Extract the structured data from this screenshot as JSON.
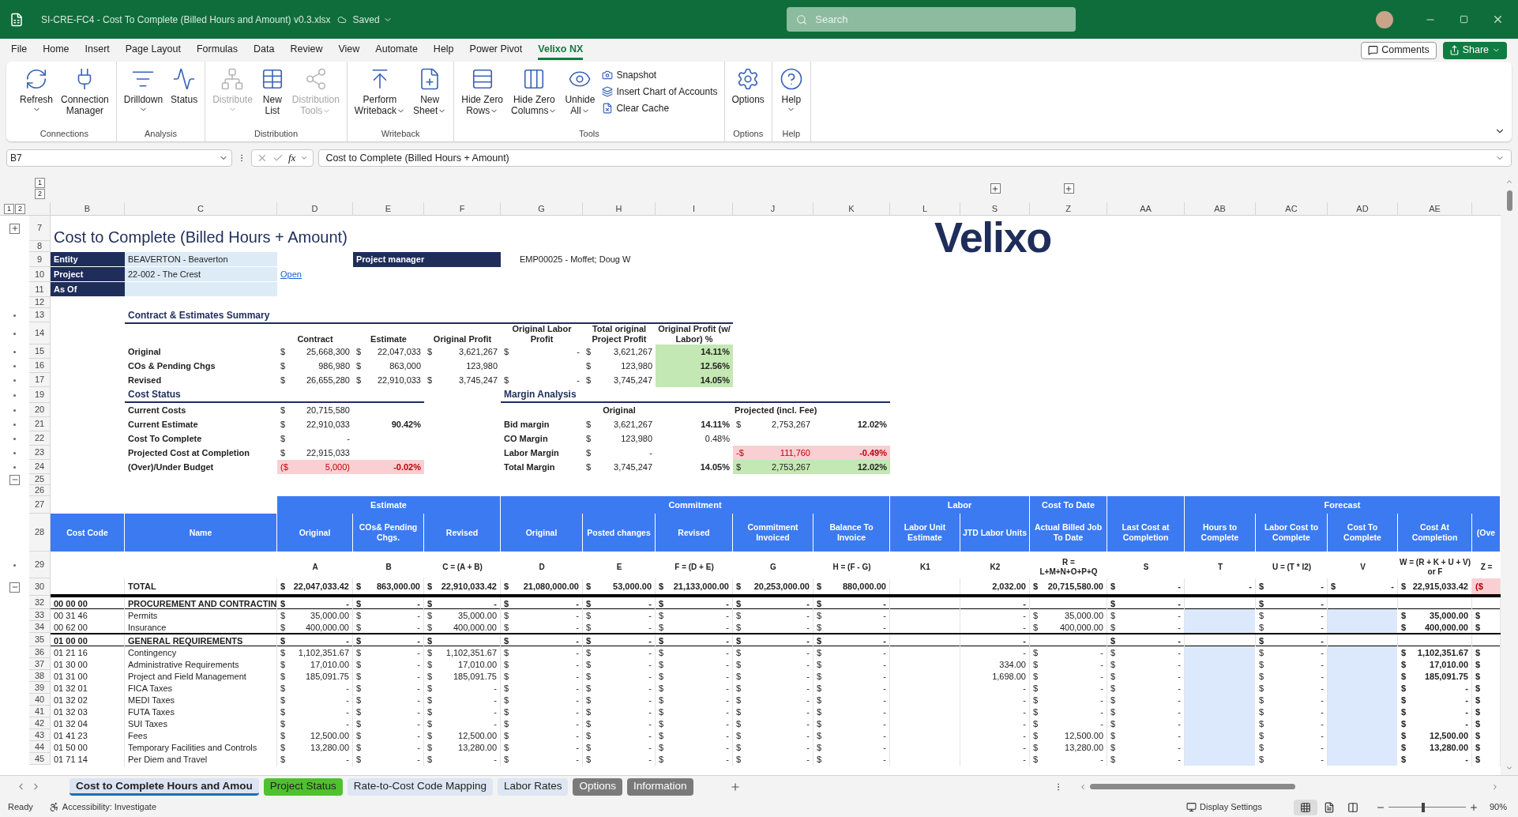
{
  "window": {
    "file_name": "SI-CRE-FC4 - Cost To Complete (Billed Hours and Amount) v0.3.xlsx",
    "save_status": "Saved",
    "search_placeholder": "Search"
  },
  "menu": [
    {
      "label": "File",
      "selected": false
    },
    {
      "label": "Home",
      "selected": false
    },
    {
      "label": "Insert",
      "selected": false
    },
    {
      "label": "Page Layout",
      "selected": false
    },
    {
      "label": "Formulas",
      "selected": false
    },
    {
      "label": "Data",
      "selected": false
    },
    {
      "label": "Review",
      "selected": false
    },
    {
      "label": "View",
      "selected": false
    },
    {
      "label": "Automate",
      "selected": false
    },
    {
      "label": "Help",
      "selected": false
    },
    {
      "label": "Power Pivot",
      "selected": false
    },
    {
      "label": "Velixo NX",
      "selected": true
    }
  ],
  "menu_actions": {
    "comments": "Comments",
    "share": "Share"
  },
  "ribbon": [
    {
      "label": "Connections",
      "buttons": [
        {
          "label": "Refresh",
          "kind": "large",
          "dropdown": true,
          "disabled": false
        },
        {
          "label": "Connection\nManager",
          "kind": "large",
          "dropdown": false,
          "disabled": false
        }
      ]
    },
    {
      "label": "Analysis",
      "buttons": [
        {
          "label": "Drilldown",
          "kind": "large",
          "dropdown": true,
          "disabled": false
        },
        {
          "label": "Status",
          "kind": "large",
          "dropdown": false,
          "disabled": false
        }
      ]
    },
    {
      "label": "Distribution",
      "buttons": [
        {
          "label": "Distribute",
          "kind": "large",
          "dropdown": true,
          "disabled": true
        },
        {
          "label": "New\nList",
          "kind": "large",
          "dropdown": false,
          "disabled": false
        },
        {
          "label": "Distribution\nTools",
          "kind": "large",
          "dropdown": true,
          "disabled": true
        }
      ]
    },
    {
      "label": "Writeback",
      "buttons": [
        {
          "label": "Perform\nWriteback",
          "kind": "large",
          "dropdown": true,
          "disabled": false
        },
        {
          "label": "New\nSheet",
          "kind": "large",
          "dropdown": true,
          "disabled": false
        }
      ]
    },
    {
      "label": "Tools",
      "buttons": [
        {
          "label": "Hide Zero\nRows",
          "kind": "large",
          "dropdown": true,
          "disabled": false
        },
        {
          "label": "Hide Zero\nColumns",
          "kind": "large",
          "dropdown": true,
          "disabled": false
        },
        {
          "label": "Unhide\nAll",
          "kind": "large",
          "dropdown": true,
          "disabled": false
        },
        {
          "label": "Snapshot",
          "kind": "small",
          "dropdown": false,
          "disabled": false
        },
        {
          "label": "Insert Chart of Accounts",
          "kind": "small",
          "dropdown": false,
          "disabled": false
        },
        {
          "label": "Clear Cache",
          "kind": "small",
          "dropdown": false,
          "disabled": false
        }
      ]
    },
    {
      "label": "Options",
      "buttons": [
        {
          "label": "Options",
          "kind": "large",
          "dropdown": false,
          "disabled": false
        }
      ]
    },
    {
      "label": "Help",
      "buttons": [
        {
          "label": "Help",
          "kind": "large",
          "dropdown": true,
          "disabled": false
        }
      ]
    }
  ],
  "formula_bar": {
    "name_box": "B7",
    "function_label": "fx",
    "content": "Cost to Complete (Billed Hours + Amount)"
  },
  "sheet": {
    "column_outline_levels": [
      "1",
      "2"
    ],
    "row_outline_levels": [
      "1",
      "2"
    ],
    "column_letters": [
      "B",
      "C",
      "D",
      "E",
      "F",
      "G",
      "H",
      "I",
      "J",
      "K",
      "L",
      "S",
      "Z",
      "AA",
      "AB",
      "AC",
      "AD",
      "AE"
    ],
    "logo_text": "Velixo",
    "rows": [
      {
        "number": "7",
        "kind": "title",
        "outline": {
          "kind": "expand"
        },
        "text": "Cost to Complete (Billed Hours + Amount)"
      },
      {
        "number": "8",
        "kind": "blank"
      },
      {
        "number": "9",
        "kind": "field",
        "label": "Entity",
        "value": "BEAVERTON - Beaverton",
        "side_label": "Project manager",
        "side_value": "EMP00025 - Moffet; Doug W"
      },
      {
        "number": "10",
        "kind": "field",
        "label": "Project",
        "value": "22-002 - The Crest",
        "link": "Open"
      },
      {
        "number": "11",
        "kind": "field",
        "label": "As Of"
      },
      {
        "number": "12",
        "kind": "blank"
      },
      {
        "number": "13",
        "kind": "section",
        "outline": {
          "kind": "dot"
        },
        "text": "Contract & Estimates Summary"
      },
      {
        "number": "14",
        "kind": "summary_header",
        "outline": {
          "kind": "dot"
        },
        "cells": [
          "Contract",
          "Estimate",
          "Original Profit",
          "Original Labor Profit",
          "Total original Project Profit",
          "Original Profit (w/ Labor) %"
        ]
      },
      {
        "number": "15",
        "kind": "summary",
        "outline": {
          "kind": "dot"
        },
        "label": "Original",
        "cells": [
          {
            "sym": "$",
            "value": "25,668,300"
          },
          {
            "sym": "$",
            "value": "22,047,033"
          },
          {
            "sym": "$",
            "value": "3,621,267"
          },
          {
            "sym": "$",
            "value": "-"
          },
          {
            "sym": "$",
            "value": "3,621,267"
          },
          {
            "value": "14.11%",
            "kind": "good",
            "bold": true
          }
        ]
      },
      {
        "number": "16",
        "kind": "summary",
        "outline": {
          "kind": "dot"
        },
        "label": "COs & Pending Chgs",
        "cells": [
          {
            "sym": "$",
            "value": "986,980"
          },
          {
            "sym": "$",
            "value": "863,000"
          },
          {
            "value": "123,980"
          },
          {},
          {
            "sym": "$",
            "value": "123,980"
          },
          {
            "value": "12.56%",
            "kind": "good",
            "bold": true
          }
        ]
      },
      {
        "number": "17",
        "kind": "summary",
        "outline": {
          "kind": "dot"
        },
        "label": "Revised",
        "cells": [
          {
            "sym": "$",
            "value": "26,655,280"
          },
          {
            "sym": "$",
            "value": "22,910,033"
          },
          {
            "sym": "$",
            "value": "3,745,247"
          },
          {
            "sym": "$",
            "value": "-"
          },
          {
            "sym": "$",
            "value": "3,745,247"
          },
          {
            "value": "14.05%",
            "kind": "good",
            "bold": true
          }
        ]
      },
      {
        "number": "19",
        "kind": "split_titles",
        "outline": {
          "kind": "dot"
        },
        "cost_title": "Cost Status",
        "margin_title": "Margin Analysis"
      },
      {
        "number": "20",
        "kind": "split",
        "outline": {
          "kind": "dot"
        },
        "cost": {
          "label": "Current Costs",
          "amount": {
            "sym": "$",
            "value": "20,715,580"
          }
        },
        "margin_header": {
          "original": "Original",
          "projected": "Projected (incl. Fee)"
        }
      },
      {
        "number": "21",
        "kind": "split",
        "outline": {
          "kind": "dot"
        },
        "cost": {
          "label": "Current Estimate",
          "amount": {
            "sym": "$",
            "value": "22,910,033"
          },
          "percent": {
            "value": "90.42%",
            "bold": true
          }
        },
        "margin": {
          "label": "Bid margin",
          "original": {
            "sym": "$",
            "value": "3,621,267"
          },
          "original_pct": {
            "value": "14.11%",
            "bold": true
          },
          "projected": {
            "sym": "$",
            "value": "2,753,267"
          },
          "projected_pct": {
            "value": "12.02%",
            "bold": true
          }
        }
      },
      {
        "number": "22",
        "kind": "split",
        "outline": {
          "kind": "dot"
        },
        "cost": {
          "label": "Cost To Complete",
          "amount": {
            "sym": "$",
            "value": "-"
          }
        },
        "margin": {
          "label": "CO Margin",
          "original": {
            "sym": "$",
            "value": "123,980"
          },
          "original_pct": {
            "value": "0.48%",
            "bold": false
          }
        }
      },
      {
        "number": "23",
        "kind": "split",
        "outline": {
          "kind": "dot"
        },
        "cost": {
          "label": "Projected Cost at Completion",
          "amount": {
            "sym": "$",
            "value": "22,915,033"
          }
        },
        "margin": {
          "label": "Labor Margin",
          "original": {
            "sym": "$",
            "value": "-"
          },
          "projected": {
            "sym": "-$",
            "value": "111,760",
            "kind": "bad"
          },
          "projected_pct": {
            "value": "-0.49%",
            "kind": "bad",
            "bold": true
          }
        }
      },
      {
        "number": "24",
        "kind": "split",
        "outline": {
          "kind": "dot"
        },
        "cost": {
          "label": "(Over)/Under Budget",
          "amount": {
            "sym": "($",
            "value": "5,000)",
            "kind": "bad"
          },
          "percent": {
            "value": "-0.02%",
            "kind": "bad",
            "bold": true
          }
        },
        "margin": {
          "label": "Total Margin",
          "original": {
            "sym": "$",
            "value": "3,745,247"
          },
          "original_pct": {
            "value": "14.05%",
            "bold": true
          },
          "projected": {
            "sym": "$",
            "value": "2,753,267",
            "kind": "good"
          },
          "projected_pct": {
            "value": "12.02%",
            "kind": "good",
            "bold": true
          }
        }
      },
      {
        "number": "25",
        "kind": "blank",
        "outline": {
          "kind": "collapse"
        }
      },
      {
        "number": "26",
        "kind": "blank"
      },
      {
        "number": "27",
        "kind": "group_header"
      },
      {
        "number": "28",
        "kind": "column_header"
      },
      {
        "number": "29",
        "kind": "formula",
        "outline": {
          "kind": "dot"
        }
      },
      {
        "number": "30",
        "kind": "total",
        "outline": {
          "kind": "collapse"
        },
        "name": "TOTAL",
        "cells": [
          {
            "sym": "$",
            "value": "22,047,033.42"
          },
          {
            "sym": "$",
            "value": "863,000.00"
          },
          {
            "sym": "$",
            "value": "22,910,033.42"
          },
          {
            "sym": "$",
            "value": "21,080,000.00"
          },
          {
            "sym": "$",
            "value": "53,000.00"
          },
          {
            "sym": "$",
            "value": "21,133,000.00"
          },
          {
            "sym": "$",
            "value": "20,253,000.00"
          },
          {
            "sym": "$",
            "value": "880,000.00"
          },
          {},
          {
            "value": "2,032.00"
          },
          {
            "sym": "$",
            "value": "20,715,580.00"
          },
          {
            "sym": "$",
            "value": "-"
          },
          {
            "value": "-"
          },
          {
            "sym": "$",
            "value": "-"
          },
          {
            "sym": "$",
            "value": "-"
          },
          {
            "sym": "$",
            "value": "22,915,033.42"
          },
          {
            "sym": "($",
            "kind": "bad"
          }
        ]
      },
      {
        "number": "32",
        "kind": "group",
        "code": "00 00 00",
        "name": "PROCUREMENT AND CONTRACTIN",
        "cells": [
          {
            "sym": "$",
            "value": "-"
          },
          {
            "sym": "$",
            "value": "-"
          },
          {
            "sym": "$",
            "value": "-"
          },
          {
            "sym": "$",
            "value": "-"
          },
          {
            "sym": "$",
            "value": "-"
          },
          {
            "sym": "$",
            "value": "-"
          },
          {
            "sym": "$",
            "value": "-"
          },
          {
            "sym": "$",
            "value": "-"
          },
          {},
          {
            "value": "-"
          },
          {},
          {
            "sym": "$",
            "value": "-"
          },
          {},
          {
            "sym": "$",
            "value": "-"
          },
          {},
          {},
          {}
        ]
      },
      {
        "number": "33",
        "kind": "item",
        "code": "00 31 46",
        "name": "Permits",
        "cells": [
          {
            "sym": "$",
            "value": "35,000.00"
          },
          {
            "sym": "$",
            "value": "-"
          },
          {
            "sym": "$",
            "value": "35,000.00"
          },
          {
            "sym": "$",
            "value": "-"
          },
          {
            "sym": "$",
            "value": "-"
          },
          {
            "sym": "$",
            "value": "-"
          },
          {
            "sym": "$",
            "value": "-"
          },
          {
            "sym": "$",
            "value": "-"
          },
          {},
          {
            "value": "-"
          },
          {
            "sym": "$",
            "value": "35,000.00"
          },
          {
            "sym": "$",
            "value": "-"
          },
          {
            "kind": "input"
          },
          {
            "sym": "$",
            "value": "-"
          },
          {
            "kind": "input"
          },
          {
            "sym": "$",
            "value": "35,000.00",
            "bold": true
          },
          {
            "sym": "$",
            "bold": true
          }
        ]
      },
      {
        "number": "34",
        "kind": "item",
        "code": "00 62 00",
        "name": "Insurance",
        "cells": [
          {
            "sym": "$",
            "value": "400,000.00"
          },
          {
            "sym": "$",
            "value": "-"
          },
          {
            "sym": "$",
            "value": "400,000.00"
          },
          {
            "sym": "$",
            "value": "-"
          },
          {
            "sym": "$",
            "value": "-"
          },
          {
            "sym": "$",
            "value": "-"
          },
          {
            "sym": "$",
            "value": "-"
          },
          {
            "sym": "$",
            "value": "-"
          },
          {},
          {
            "value": "-"
          },
          {
            "sym": "$",
            "value": "400,000.00"
          },
          {
            "sym": "$",
            "value": "-"
          },
          {
            "kind": "input"
          },
          {
            "sym": "$",
            "value": "-"
          },
          {
            "kind": "input"
          },
          {
            "sym": "$",
            "value": "400,000.00",
            "bold": true
          },
          {
            "sym": "$",
            "bold": true
          }
        ]
      },
      {
        "number": "35",
        "kind": "group",
        "code": "01 00 00",
        "name": "GENERAL REQUIREMENTS",
        "cells": [
          {
            "sym": "$",
            "value": "-"
          },
          {
            "sym": "$",
            "value": "-"
          },
          {
            "sym": "$"
          },
          {
            "sym": "$",
            "value": "-"
          },
          {
            "sym": "$",
            "value": "-"
          },
          {
            "sym": "$",
            "value": "-"
          },
          {
            "sym": "$",
            "value": "-"
          },
          {
            "sym": "$",
            "value": "-"
          },
          {},
          {
            "value": "-"
          },
          {},
          {
            "sym": "$",
            "value": "-"
          },
          {},
          {
            "sym": "$",
            "value": "-"
          },
          {},
          {},
          {}
        ]
      },
      {
        "number": "36",
        "kind": "item",
        "code": "01 21 16",
        "name": "Contingency",
        "cells": [
          {
            "sym": "$",
            "value": "1,102,351.67"
          },
          {
            "sym": "$",
            "value": "-"
          },
          {
            "sym": "$",
            "value": "1,102,351.67"
          },
          {
            "sym": "$",
            "value": "-"
          },
          {
            "sym": "$",
            "value": "-"
          },
          {
            "sym": "$",
            "value": "-"
          },
          {
            "sym": "$",
            "value": "-"
          },
          {
            "sym": "$",
            "value": "-"
          },
          {},
          {
            "value": "-"
          },
          {
            "sym": "$",
            "value": "-"
          },
          {
            "sym": "$",
            "value": "-"
          },
          {
            "kind": "input"
          },
          {
            "sym": "$",
            "value": "-"
          },
          {
            "kind": "input"
          },
          {
            "sym": "$",
            "value": "1,102,351.67",
            "bold": true
          },
          {
            "sym": "$",
            "bold": true
          }
        ]
      },
      {
        "number": "37",
        "kind": "item",
        "code": "01 30 00",
        "name": "Administrative Requirements",
        "cells": [
          {
            "sym": "$",
            "value": "17,010.00"
          },
          {
            "sym": "$",
            "value": "-"
          },
          {
            "sym": "$",
            "value": "17,010.00"
          },
          {
            "sym": "$",
            "value": "-"
          },
          {
            "sym": "$",
            "value": "-"
          },
          {
            "sym": "$",
            "value": "-"
          },
          {
            "sym": "$",
            "value": "-"
          },
          {
            "sym": "$",
            "value": "-"
          },
          {},
          {
            "value": "334.00"
          },
          {
            "sym": "$",
            "value": "-"
          },
          {
            "sym": "$",
            "value": "-"
          },
          {
            "kind": "input"
          },
          {
            "sym": "$",
            "value": "-"
          },
          {
            "kind": "input"
          },
          {
            "sym": "$",
            "value": "17,010.00",
            "bold": true
          },
          {
            "sym": "$",
            "bold": true
          }
        ]
      },
      {
        "number": "38",
        "kind": "item",
        "code": "01 31 00",
        "name": "Project and Field Management",
        "cells": [
          {
            "sym": "$",
            "value": "185,091.75"
          },
          {
            "sym": "$",
            "value": "-"
          },
          {
            "sym": "$",
            "value": "185,091.75"
          },
          {
            "sym": "$",
            "value": "-"
          },
          {
            "sym": "$",
            "value": "-"
          },
          {
            "sym": "$",
            "value": "-"
          },
          {
            "sym": "$",
            "value": "-"
          },
          {
            "sym": "$",
            "value": "-"
          },
          {},
          {
            "value": "1,698.00"
          },
          {
            "sym": "$",
            "value": "-"
          },
          {
            "sym": "$",
            "value": "-"
          },
          {
            "kind": "input"
          },
          {
            "sym": "$",
            "value": "-"
          },
          {
            "kind": "input"
          },
          {
            "sym": "$",
            "value": "185,091.75",
            "bold": true
          },
          {
            "sym": "$",
            "bold": true
          }
        ]
      },
      {
        "number": "39",
        "kind": "item",
        "code": "01 32 01",
        "name": "FICA Taxes",
        "cells": [
          {
            "sym": "$",
            "value": "-"
          },
          {
            "sym": "$",
            "value": "-"
          },
          {
            "sym": "$",
            "value": "-"
          },
          {
            "sym": "$",
            "value": "-"
          },
          {
            "sym": "$",
            "value": "-"
          },
          {
            "sym": "$",
            "value": "-"
          },
          {
            "sym": "$",
            "value": "-"
          },
          {
            "sym": "$",
            "value": "-"
          },
          {},
          {
            "value": "-"
          },
          {
            "sym": "$",
            "value": "-"
          },
          {
            "sym": "$",
            "value": "-"
          },
          {
            "kind": "input"
          },
          {
            "sym": "$",
            "value": "-"
          },
          {
            "kind": "input"
          },
          {
            "sym": "$",
            "value": "-",
            "bold": true
          },
          {
            "sym": "$",
            "bold": true
          }
        ]
      },
      {
        "number": "40",
        "kind": "item",
        "code": "01 32 02",
        "name": "MEDI Taxes",
        "cells": [
          {
            "sym": "$",
            "value": "-"
          },
          {
            "sym": "$",
            "value": "-"
          },
          {
            "sym": "$",
            "value": "-"
          },
          {
            "sym": "$",
            "value": "-"
          },
          {
            "sym": "$",
            "value": "-"
          },
          {
            "sym": "$",
            "value": "-"
          },
          {
            "sym": "$",
            "value": "-"
          },
          {
            "sym": "$",
            "value": "-"
          },
          {},
          {
            "value": "-"
          },
          {
            "sym": "$",
            "value": "-"
          },
          {
            "sym": "$",
            "value": "-"
          },
          {
            "kind": "input"
          },
          {
            "sym": "$",
            "value": "-"
          },
          {
            "kind": "input"
          },
          {
            "sym": "$",
            "value": "-",
            "bold": true
          },
          {
            "sym": "$",
            "bold": true
          }
        ]
      },
      {
        "number": "41",
        "kind": "item",
        "code": "01 32 03",
        "name": "FUTA Taxes",
        "cells": [
          {
            "sym": "$",
            "value": "-"
          },
          {
            "sym": "$",
            "value": "-"
          },
          {
            "sym": "$",
            "value": "-"
          },
          {
            "sym": "$",
            "value": "-"
          },
          {
            "sym": "$",
            "value": "-"
          },
          {
            "sym": "$",
            "value": "-"
          },
          {
            "sym": "$",
            "value": "-"
          },
          {
            "sym": "$",
            "value": "-"
          },
          {},
          {
            "value": "-"
          },
          {
            "sym": "$",
            "value": "-"
          },
          {
            "sym": "$",
            "value": "-"
          },
          {
            "kind": "input"
          },
          {
            "sym": "$",
            "value": "-"
          },
          {
            "kind": "input"
          },
          {
            "sym": "$",
            "value": "-",
            "bold": true
          },
          {
            "sym": "$",
            "bold": true
          }
        ]
      },
      {
        "number": "42",
        "kind": "item",
        "code": "01 32 04",
        "name": "SUI Taxes",
        "cells": [
          {
            "sym": "$",
            "value": "-"
          },
          {
            "sym": "$",
            "value": "-"
          },
          {
            "sym": "$",
            "value": "-"
          },
          {
            "sym": "$",
            "value": "-"
          },
          {
            "sym": "$",
            "value": "-"
          },
          {
            "sym": "$",
            "value": "-"
          },
          {
            "sym": "$",
            "value": "-"
          },
          {
            "sym": "$",
            "value": "-"
          },
          {},
          {
            "value": "-"
          },
          {
            "sym": "$",
            "value": "-"
          },
          {
            "sym": "$",
            "value": "-"
          },
          {
            "kind": "input"
          },
          {
            "sym": "$",
            "value": "-"
          },
          {
            "kind": "input"
          },
          {
            "sym": "$",
            "value": "-",
            "bold": true
          },
          {
            "sym": "$",
            "bold": true
          }
        ]
      },
      {
        "number": "43",
        "kind": "item",
        "code": "01 41 23",
        "name": "Fees",
        "cells": [
          {
            "sym": "$",
            "value": "12,500.00"
          },
          {
            "sym": "$",
            "value": "-"
          },
          {
            "sym": "$",
            "value": "12,500.00"
          },
          {
            "sym": "$",
            "value": "-"
          },
          {
            "sym": "$",
            "value": "-"
          },
          {
            "sym": "$",
            "value": "-"
          },
          {
            "sym": "$",
            "value": "-"
          },
          {
            "sym": "$",
            "value": "-"
          },
          {},
          {
            "value": "-"
          },
          {
            "sym": "$",
            "value": "12,500.00"
          },
          {
            "sym": "$",
            "value": "-"
          },
          {
            "kind": "input"
          },
          {
            "sym": "$",
            "value": "-"
          },
          {
            "kind": "input"
          },
          {
            "sym": "$",
            "value": "12,500.00",
            "bold": true
          },
          {
            "sym": "$",
            "bold": true
          }
        ]
      },
      {
        "number": "44",
        "kind": "item",
        "code": "01 50 00",
        "name": "Temporary Facilities and Controls",
        "cells": [
          {
            "sym": "$",
            "value": "13,280.00"
          },
          {
            "sym": "$",
            "value": "-"
          },
          {
            "sym": "$",
            "value": "13,280.00"
          },
          {
            "sym": "$",
            "value": "-"
          },
          {
            "sym": "$",
            "value": "-"
          },
          {
            "sym": "$",
            "value": "-"
          },
          {
            "sym": "$",
            "value": "-"
          },
          {
            "sym": "$",
            "value": "-"
          },
          {},
          {
            "value": "-"
          },
          {
            "sym": "$",
            "value": "13,280.00"
          },
          {
            "sym": "$",
            "value": "-"
          },
          {
            "kind": "input"
          },
          {
            "sym": "$",
            "value": "-"
          },
          {
            "kind": "input"
          },
          {
            "sym": "$",
            "value": "13,280.00",
            "bold": true
          },
          {
            "sym": "$",
            "bold": true
          }
        ]
      },
      {
        "number": "45",
        "kind": "item",
        "code": "01 71 14",
        "name": "Per Diem and Travel",
        "cells": [
          {
            "sym": "$",
            "value": "-"
          },
          {
            "sym": "$",
            "value": "-"
          },
          {
            "sym": "$",
            "value": "-"
          },
          {
            "sym": "$",
            "value": "-"
          },
          {
            "sym": "$",
            "value": "-"
          },
          {
            "sym": "$",
            "value": "-"
          },
          {
            "sym": "$",
            "value": "-"
          },
          {
            "sym": "$",
            "value": "-"
          },
          {},
          {
            "value": "-"
          },
          {
            "sym": "$",
            "value": "-"
          },
          {
            "sym": "$",
            "value": "-"
          },
          {
            "kind": "input"
          },
          {
            "sym": "$",
            "value": "-"
          },
          {
            "kind": "input"
          },
          {
            "sym": "$",
            "value": "-",
            "bold": true
          },
          {
            "sym": "$",
            "bold": true
          }
        ]
      }
    ]
  },
  "table": {
    "fixed_columns": [
      {
        "label": "Cost Code"
      },
      {
        "label": "Name"
      }
    ],
    "groups": [
      {
        "label": "Estimate",
        "columns": [
          {
            "label": "Original",
            "formula": "A"
          },
          {
            "label": "COs& Pending Chgs.",
            "formula": "B"
          },
          {
            "label": "Revised",
            "formula": "C = (A + B)"
          }
        ]
      },
      {
        "label": "Commitment",
        "columns": [
          {
            "label": "Original",
            "formula": "D"
          },
          {
            "label": "Posted changes",
            "formula": "E"
          },
          {
            "label": "Revised",
            "formula": "F = (D + E)"
          },
          {
            "label": "Commitment Invoiced",
            "formula": "G"
          },
          {
            "label": "Balance To Invoice",
            "formula": "H = (F - G)"
          }
        ]
      },
      {
        "label": "Labor",
        "columns": [
          {
            "label": "Labor Unit Estimate",
            "formula": "K1"
          },
          {
            "label": "JTD Labor Units",
            "formula": "K2"
          }
        ]
      },
      {
        "label": "Cost To Date",
        "columns": [
          {
            "label": "Actual Billed Job To Date",
            "formula": "R =\nL+M+N+O+P+Q"
          }
        ]
      },
      {
        "columns": [
          {
            "label": "Last Cost at Completion",
            "formula": "S"
          }
        ]
      },
      {
        "label": "Forecast",
        "columns": [
          {
            "label": "Hours to Complete",
            "formula": "T"
          },
          {
            "label": "Labor Cost to Complete",
            "formula": "U = (T * I2)"
          },
          {
            "label": "Cost To Complete",
            "formula": "V"
          },
          {
            "label": "Cost At Completion",
            "formula": "W = (R + K + U + V)\nor F"
          },
          {
            "label": "(Ove",
            "formula": "Z ="
          }
        ]
      }
    ]
  },
  "sheet_tabs": [
    {
      "label": "Cost to Complete Hours and Amou",
      "selected": true,
      "color": "#dbe4f3"
    },
    {
      "label": "Project Status",
      "selected": false,
      "color": "#4fc12e"
    },
    {
      "label": "Rate-to-Cost Code Mapping",
      "selected": false,
      "color": "#dde6f2"
    },
    {
      "label": "Labor Rates",
      "selected": false,
      "color": "#dde6f2"
    },
    {
      "label": "Options",
      "selected": false,
      "color": "#7a7a7a"
    },
    {
      "label": "Information",
      "selected": false,
      "color": "#7a7a7a"
    }
  ],
  "status_bar": {
    "mode": "Ready",
    "accessibility": "Accessibility: Investigate",
    "display_settings": "Display Settings",
    "views": [
      {
        "selected": true
      },
      {
        "selected": false
      },
      {
        "selected": false
      }
    ],
    "zoom": {
      "level": 0.45,
      "reading": "90%"
    }
  }
}
